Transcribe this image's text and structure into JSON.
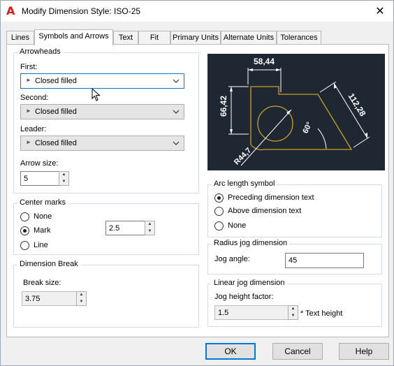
{
  "window": {
    "title": "Modify Dimension Style: ISO-25",
    "close_glyph": "✕",
    "app_icon_glyph": "A"
  },
  "tabs": [
    {
      "label": "Lines"
    },
    {
      "label": "Symbols and Arrows",
      "active": true
    },
    {
      "label": "Text"
    },
    {
      "label": "Fit"
    },
    {
      "label": "Primary Units"
    },
    {
      "label": "Alternate Units"
    },
    {
      "label": "Tolerances"
    }
  ],
  "arrowheads": {
    "title": "Arrowheads",
    "first_label": "First:",
    "first_value": "Closed filled",
    "second_label": "Second:",
    "second_value": "Closed filled",
    "leader_label": "Leader:",
    "leader_value": "Closed filled",
    "size_label": "Arrow size:",
    "size_value": "5"
  },
  "center_marks": {
    "title": "Center marks",
    "options": [
      "None",
      "Mark",
      "Line"
    ],
    "selected": "Mark",
    "size_value": "2.5"
  },
  "dimension_break": {
    "title": "Dimension Break",
    "size_label": "Break size:",
    "size_value": "3.75"
  },
  "preview": {
    "dims": {
      "top": "58,44",
      "left": "66,42",
      "right": "112,28",
      "angle": "60°",
      "radius": "R44,7"
    }
  },
  "arc_length": {
    "title": "Arc length symbol",
    "options": [
      "Preceding dimension text",
      "Above dimension text",
      "None"
    ],
    "selected": "Preceding dimension text"
  },
  "radius_jog": {
    "title": "Radius jog dimension",
    "angle_label": "Jog angle:",
    "angle_value": "45"
  },
  "linear_jog": {
    "title": "Linear jog dimension",
    "height_label": "Jog height factor:",
    "height_value": "1.5",
    "suffix": "* Text height"
  },
  "buttons": {
    "ok": "OK",
    "cancel": "Cancel",
    "help": "Help"
  },
  "colors": {
    "preview_bg": "#1f2733",
    "preview_line": "#c9a227",
    "accent": "#0078d7",
    "app_icon": "#d41f1f"
  },
  "icons": {
    "close": "close-icon",
    "dropdown": "chevron-down-icon",
    "arrowhead": "arrowhead-icon"
  }
}
